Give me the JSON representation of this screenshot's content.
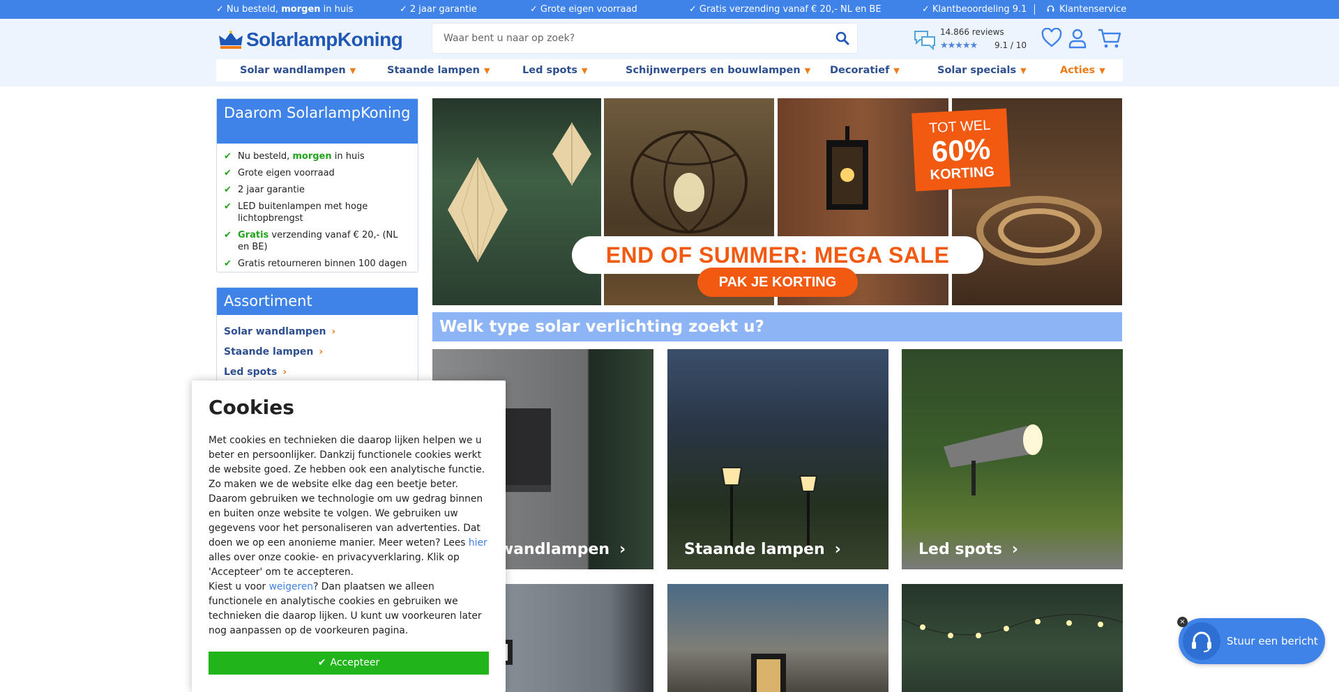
{
  "topbar": {
    "items": [
      {
        "pre": "Nu besteld, ",
        "bold": "morgen",
        "post": " in huis"
      },
      {
        "text": "2 jaar garantie"
      },
      {
        "text": "Grote eigen voorraad"
      },
      {
        "text": "Gratis verzending vanaf € 20,- NL en BE"
      },
      {
        "text": "Klantbeoordeling 9.1"
      }
    ],
    "service": "Klantenservice",
    "bg_color": "#3f82e8"
  },
  "header": {
    "logo": "SolarlampKoning",
    "search_placeholder": "Waar bent u naar op zoek?",
    "reviews_count": "14.866 reviews",
    "reviews_stars": "★★★★★",
    "reviews_score": "9.1 / 10",
    "icons": [
      "search-icon",
      "reviews-icon",
      "heart-icon",
      "user-icon",
      "cart-icon"
    ]
  },
  "nav": {
    "items": [
      {
        "label": "Solar wandlampen"
      },
      {
        "label": "Staande lampen"
      },
      {
        "label": "Led spots"
      },
      {
        "label": "Schijnwerpers en bouwlampen"
      },
      {
        "label": "Decoratief"
      },
      {
        "label": "Solar specials"
      },
      {
        "label": "Acties"
      }
    ],
    "accent": "#f07b16"
  },
  "why": {
    "title": "Daarom SolarlampKoning",
    "items": [
      {
        "pre": "Nu besteld, ",
        "bold": "morgen",
        "post": " in huis"
      },
      {
        "text": "Grote eigen voorraad"
      },
      {
        "text": "2 jaar garantie"
      },
      {
        "text": "LED buitenlampen met hoge lichtopbrengst"
      },
      {
        "pre": "",
        "bold": "Gratis",
        "post": " verzending vanaf € 20,- (NL en BE)"
      },
      {
        "text": "Gratis retourneren binnen 100 dagen"
      }
    ]
  },
  "assortiment": {
    "title": "Assortiment",
    "links": [
      "Solar wandlampen",
      "Staande lampen",
      "Led spots"
    ]
  },
  "banner": {
    "badge_line1": "TOT WEL",
    "badge_line2": "60%",
    "badge_line3": "KORTING",
    "sale": "END OF SUMMER: MEGA SALE",
    "cta": "PAK JE KORTING"
  },
  "categories": {
    "title": "Welk type solar verlichting zoekt u?",
    "cards": [
      {
        "label": "Solar wandlampen"
      },
      {
        "label": "Staande lampen"
      },
      {
        "label": "Led spots"
      },
      {
        "label": ""
      },
      {
        "label": ""
      },
      {
        "label": ""
      }
    ]
  },
  "cookies": {
    "title": "Cookies",
    "p1": "Met cookies en technieken die daarop lijken helpen we u beter en persoonlijker. Dankzij functionele cookies werkt de website goed. Ze hebben ook een analytische functie. Zo maken we de website elke dag een beetje beter. Daarom gebruiken we technologie om uw gedrag binnen en buiten onze website te volgen. We gebruiken uw gegevens voor het personaliseren van advertenties. Dat doen we op een anonieme manier. Meer weten? Lees ",
    "p1_link": "hier",
    "p1_end": " alles over onze cookie- en privacyverklaring. Klik op 'Accepteer' om te accepteren.",
    "p2_pre": "Kiest u voor ",
    "p2_link": "weigeren",
    "p2_end": "? Dan plaatsen we alleen functionele en analytische cookies en gebruiken we technieken die daarop lijken. U kunt uw voorkeuren later nog aanpassen op de voorkeuren pagina.",
    "accept": "Accepteer",
    "accept_color": "#21b41b"
  },
  "chat": {
    "label": "Stuur een bericht",
    "close": "×"
  }
}
